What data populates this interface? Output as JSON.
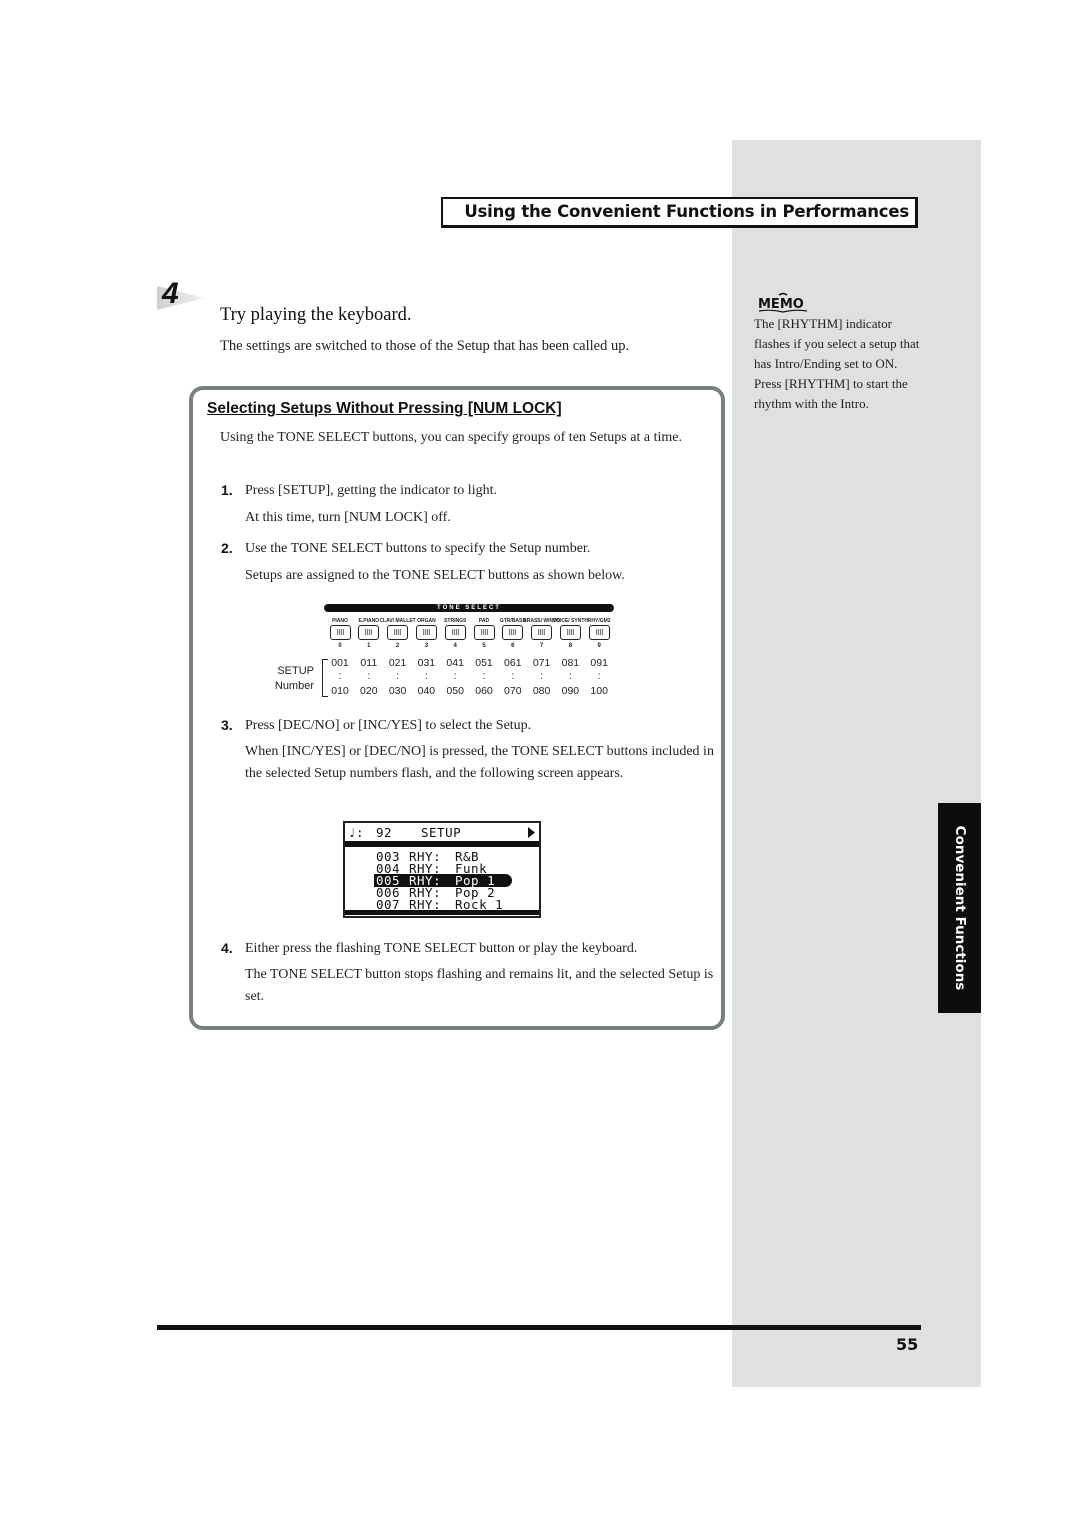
{
  "section_header": "Using the Convenient Functions in Performances",
  "step": {
    "number": "4",
    "title": "Try playing the keyboard.",
    "description": "The settings are switched to those of the Setup that has been called up."
  },
  "memo": {
    "icon_label": "MEMO",
    "text": "The [RHYTHM] indicator flashes if you select a setup that has Intro/Ending set to ON. Press [RHYTHM] to start the rhythm with the Intro."
  },
  "panel": {
    "title": "Selecting Setups Without Pressing [NUM LOCK]",
    "intro": "Using the TONE SELECT buttons, you can specify groups of ten Setups at a time.",
    "steps": [
      {
        "label": "1.",
        "text": "Press [SETUP], getting the indicator to light.",
        "sub": "At this time, turn [NUM LOCK] off."
      },
      {
        "label": "2.",
        "text": "Use the TONE SELECT buttons to specify the Setup number.",
        "sub": "Setups are assigned to the TONE SELECT buttons as shown below."
      },
      {
        "label": "3.",
        "text": "Press [DEC/NO] or [INC/YES] to select the Setup.",
        "sub": "When [INC/YES] or [DEC/NO] is pressed, the TONE SELECT buttons included in the selected Setup numbers flash, and the following screen appears."
      },
      {
        "label": "4.",
        "text": "Either press the flashing TONE SELECT button or play the keyboard.",
        "sub": "The TONE SELECT button stops flashing and remains lit, and the selected Setup is set."
      }
    ]
  },
  "tone_select": {
    "title": "TONE SELECT",
    "buttons": [
      {
        "name": "PIANO",
        "index": "0",
        "start": "001",
        "end": "010"
      },
      {
        "name": "E.PIANO",
        "index": "1",
        "start": "011",
        "end": "020"
      },
      {
        "name": "CLAV/ MALLET",
        "index": "2",
        "start": "021",
        "end": "030"
      },
      {
        "name": "ORGAN",
        "index": "3",
        "start": "031",
        "end": "040"
      },
      {
        "name": "STRINGS",
        "index": "4",
        "start": "041",
        "end": "050"
      },
      {
        "name": "PAD",
        "index": "5",
        "start": "051",
        "end": "060"
      },
      {
        "name": "GTR/BASS",
        "index": "6",
        "start": "061",
        "end": "070"
      },
      {
        "name": "BRASS/ WINDS",
        "index": "7",
        "start": "071",
        "end": "080"
      },
      {
        "name": "VOICE/ SYNTH",
        "index": "8",
        "start": "081",
        "end": "090"
      },
      {
        "name": "RHY/GM2",
        "index": "9",
        "start": "091",
        "end": "100"
      }
    ],
    "setup_label_1": "SETUP",
    "setup_label_2": "Number",
    "ellipsis": ":"
  },
  "lcd": {
    "header_left": "♩:",
    "tempo": "92",
    "mode": "SETUP",
    "rows": [
      {
        "num": "003",
        "cat": "RHY:",
        "name": "R&B",
        "selected": false
      },
      {
        "num": "004",
        "cat": "RHY:",
        "name": "Funk",
        "selected": false
      },
      {
        "num": "005",
        "cat": "RHY:",
        "name": "Pop 1",
        "selected": true
      },
      {
        "num": "006",
        "cat": "RHY:",
        "name": "Pop 2",
        "selected": false
      },
      {
        "num": "007",
        "cat": "RHY:",
        "name": "Rock 1",
        "selected": false
      }
    ]
  },
  "side_tab": "Convenient Functions",
  "page_number": "55"
}
